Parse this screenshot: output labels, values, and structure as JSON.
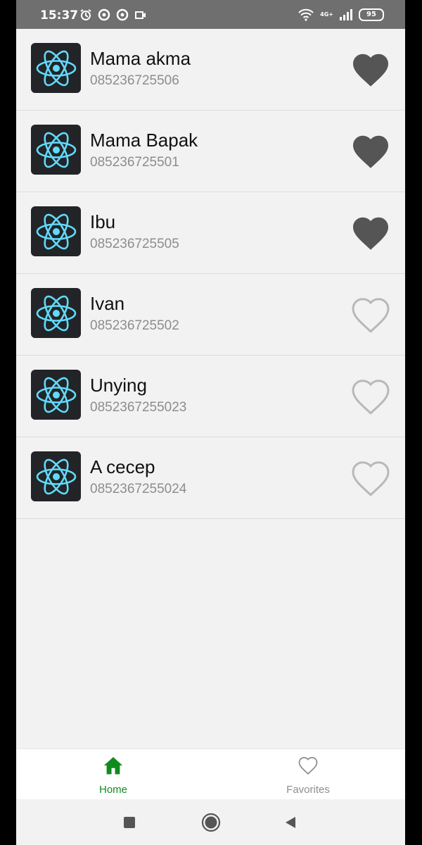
{
  "status_bar": {
    "time": "15:37",
    "network": "4G+",
    "battery": "95"
  },
  "contacts": [
    {
      "name": "Mama akma",
      "phone": "085236725506",
      "favorite": true
    },
    {
      "name": "Mama Bapak",
      "phone": "085236725501",
      "favorite": true
    },
    {
      "name": "Ibu",
      "phone": "085236725505",
      "favorite": true
    },
    {
      "name": "Ivan",
      "phone": "085236725502",
      "favorite": false
    },
    {
      "name": "Unying",
      "phone": "0852367255023",
      "favorite": false
    },
    {
      "name": "A cecep",
      "phone": "0852367255024",
      "favorite": false
    }
  ],
  "tab_bar": {
    "home_label": "Home",
    "favorites_label": "Favorites",
    "active_tab": "Home"
  },
  "colors": {
    "accent": "#118a1e",
    "heart_filled": "#555555",
    "heart_outline": "#b8b8ba",
    "react_logo": "#61dafb"
  },
  "icons": {
    "avatar": "react-logo-icon",
    "favorite_on": "heart-filled-icon",
    "favorite_off": "heart-outline-icon",
    "home_tab": "home-icon",
    "favorites_tab": "heart-outline-icon"
  }
}
